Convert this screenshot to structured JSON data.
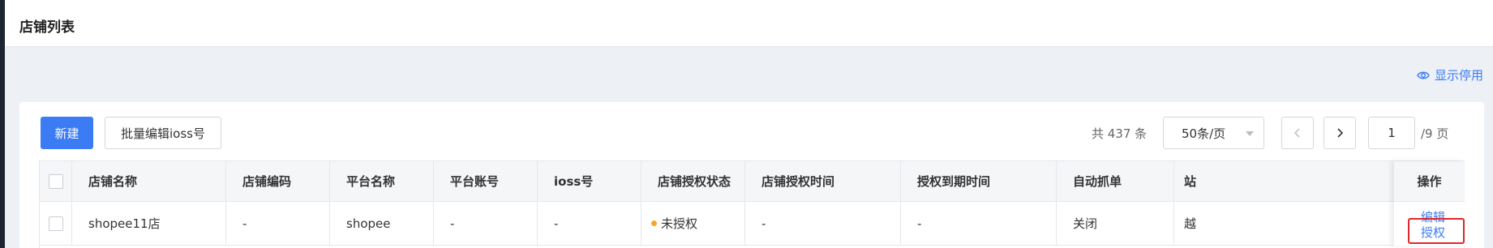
{
  "header": {
    "title": "店铺列表"
  },
  "toolbar": {
    "show_disabled_label": "显示停用",
    "new_label": "新建",
    "batch_edit_label": "批量编辑ioss号"
  },
  "pagination": {
    "total_text": "共 437 条",
    "page_size": "50条/页",
    "current_page": "1",
    "total_pages_text": "/9 页"
  },
  "table": {
    "columns": [
      "店铺名称",
      "店铺编码",
      "平台名称",
      "平台账号",
      "ioss号",
      "店铺授权状态",
      "店铺授权时间",
      "授权到期时间",
      "自动抓单",
      "站",
      "操作"
    ],
    "rows": [
      {
        "shop_name": "shopee11店",
        "shop_code": "-",
        "platform_name": "shopee",
        "platform_account": "-",
        "ioss": "-",
        "auth_status": "未授权",
        "auth_time": "-",
        "expire_time": "-",
        "auto_fetch": "关闭",
        "site": "越",
        "actions": [
          "编辑",
          "授权"
        ]
      }
    ]
  },
  "colors": {
    "primary": "#3b7cf5",
    "status_unauthorized": "#f5a623",
    "highlight": "#e0262b"
  }
}
